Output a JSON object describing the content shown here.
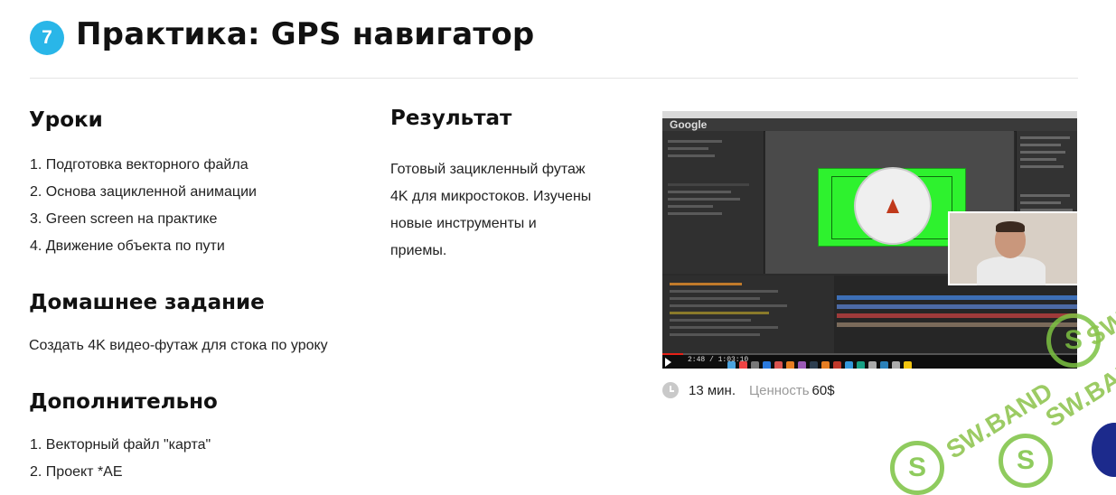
{
  "header": {
    "step_number": "7",
    "title": "Практика: GPS навигатор"
  },
  "lessons": {
    "heading": "Уроки",
    "items": [
      "1. Подготовка векторного файла",
      "2. Основа зацикленной анимации",
      "3. Green screen на практике",
      "4. Движение объекта по пути"
    ]
  },
  "homework": {
    "heading": "Домашнее задание",
    "text": "Создать 4K видео-футаж для стока по уроку"
  },
  "extra": {
    "heading": "Дополнительно",
    "items": [
      "1. Векторный файл \"карта\"",
      "2. Проект *AE"
    ]
  },
  "result": {
    "heading": "Результат",
    "text_lines": [
      "Готовый зацикленный футаж",
      "4K для микростоков. Изучены",
      "новые инструменты и",
      "приемы."
    ]
  },
  "video": {
    "app_logo": "Google",
    "time_display": "2:48 / 1:03:10",
    "progress_fraction": 0.05
  },
  "meta": {
    "duration": "13 мин.",
    "price_label": "Ценность",
    "price_value": "60$"
  },
  "watermark": {
    "text": "SW.BAND",
    "logo_letter": "S",
    "color": "#7cc242"
  },
  "colors": {
    "badge": "#29b6e8",
    "green_screen": "#2ef22e"
  }
}
